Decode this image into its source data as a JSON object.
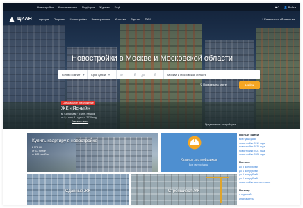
{
  "top_links": [
    "Новостройки",
    "Коммерческая",
    "Подборки",
    "Журнал",
    "Ещё"
  ],
  "top_right": {
    "favorites_count": "0",
    "login": "Войти"
  },
  "nav": {
    "logo_text": "ЦИАН",
    "items": [
      "Аренда",
      "Продажа",
      "Новостройки",
      "Коммерческая",
      "Ипотека",
      "Оценка",
      "ПИК"
    ],
    "add_ad": "+ Разместить объявление"
  },
  "hero": {
    "title": "Новостройки в Москве и Московской области",
    "search": {
      "rooms": "Кол-во комнат",
      "deadline": "Срок сдачи",
      "price_from": "от",
      "price_to": "до",
      "location": "Москва и Московская область"
    },
    "map_link": "Показать на карте",
    "find_button": "Найти",
    "promo": {
      "badge": "Специальное предложение",
      "title": "ЖК «Ясный»",
      "line1": "м. Саларьево · 5 мин. пешком",
      "line2": "от 5,4 млн ₽ · сдача в 2020 году",
      "link": "Узнать цены"
    },
    "caption": "Предложение застройщика"
  },
  "cards": {
    "buy": {
      "title": "Купить квартиру в новостройке",
      "stat1": "2 376 ЖК",
      "stat2": "от 3,2 млн ₽",
      "stat3": "от 120 тыс ₽/м²"
    },
    "catalog": {
      "title": "Каталог застройщиков",
      "sub": "Все застройщики"
    },
    "ready": {
      "title": "Сданные ЖК"
    },
    "building": {
      "title": "Строящиеся ЖК"
    }
  },
  "sidebar": {
    "sections": [
      {
        "heading": "По году сдачи",
        "links": [
          "все годы сдачи",
          "новостройки 2019 года",
          "новостройки 2020 года",
          "новостройки 2021 года",
          "новостройки 2022 года"
        ]
      },
      {
        "heading": "По цене",
        "links": [
          "до 3 млн рублей",
          "до 4 млн рублей",
          "до 5 млн рублей",
          "до 6 млн рублей",
          "новостройки эконом-класса"
        ]
      },
      {
        "heading": "По типу",
        "links": [
          "с отделкой",
          "апартаменты"
        ]
      }
    ]
  },
  "colors": {
    "accent": "#f5a623",
    "link": "#2b77d4",
    "badge": "#e0322b",
    "catalog_bg": "#4e8fd0"
  }
}
